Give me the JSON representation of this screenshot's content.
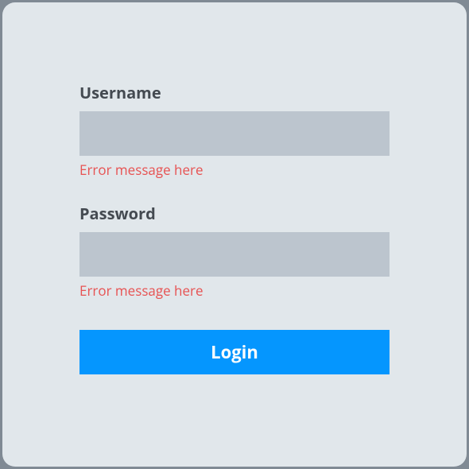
{
  "form": {
    "username": {
      "label": "Username",
      "value": "",
      "placeholder": "",
      "error": "Error message here"
    },
    "password": {
      "label": "Password",
      "value": "",
      "placeholder": "",
      "error": "Error message here"
    },
    "submit_label": "Login"
  },
  "colors": {
    "panel_bg": "#e1e7eb",
    "input_bg": "#bcc5ce",
    "label_text": "#444a51",
    "error_text": "#e75252",
    "button_bg": "#0596fe",
    "button_text": "#fdfdfd"
  }
}
